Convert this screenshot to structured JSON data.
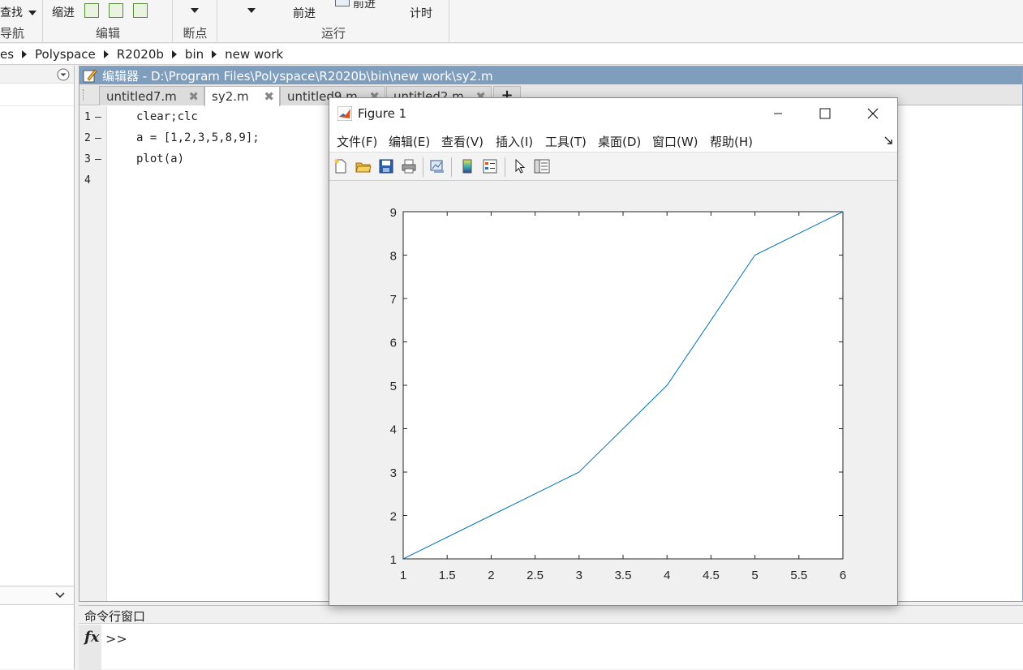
{
  "ribbon": {
    "find_label": "查找",
    "nav_label": "导航",
    "indent_label": "缩进",
    "edit_section": "编辑",
    "breakpoint_section": "断点",
    "run_section": "运行",
    "run_forward_label": "前进",
    "forward_label": "前进",
    "timer_label": "计时"
  },
  "address": {
    "segments": [
      "es",
      "Polyspace",
      "R2020b",
      "bin",
      "new work"
    ]
  },
  "editor": {
    "title": "编辑器 - D:\\Program Files\\Polyspace\\R2020b\\bin\\new work\\sy2.m",
    "tabs": [
      {
        "label": "untitled7.m"
      },
      {
        "label": "sy2.m"
      },
      {
        "label": "untitled9.m"
      },
      {
        "label": "untitled2.m"
      }
    ],
    "add_tab": "+",
    "lines": [
      {
        "num": "1",
        "marker": "—",
        "code": "clear;clc"
      },
      {
        "num": "2",
        "marker": "—",
        "code": "a = [1,2,3,5,8,9];"
      },
      {
        "num": "3",
        "marker": "—",
        "code": "plot(a)"
      },
      {
        "num": "4",
        "marker": "",
        "code": ""
      }
    ]
  },
  "command": {
    "title": "命令行窗口",
    "fx": "fx",
    "prompt": ">>"
  },
  "figure": {
    "title": "Figure 1",
    "menu": [
      "文件(F)",
      "编辑(E)",
      "查看(V)",
      "插入(I)",
      "工具(T)",
      "桌面(D)",
      "窗口(W)",
      "帮助(H)"
    ],
    "toolbar_icons": [
      "new-figure-icon",
      "open-file-icon",
      "save-icon",
      "print-icon",
      "link-plot-icon",
      "colorbar-icon",
      "legend-icon",
      "pointer-icon",
      "property-inspector-icon"
    ]
  },
  "chart_data": {
    "type": "line",
    "x": [
      1,
      2,
      3,
      4,
      5,
      6
    ],
    "series": [
      {
        "values": [
          1,
          2,
          3,
          5,
          8,
          9
        ],
        "color": "#0072bd"
      }
    ],
    "xlim": [
      1,
      6
    ],
    "ylim": [
      1,
      9
    ],
    "xticks": [
      "1",
      "1.5",
      "2",
      "2.5",
      "3",
      "3.5",
      "4",
      "4.5",
      "5",
      "5.5",
      "6"
    ],
    "xtick_values": [
      1,
      1.5,
      2,
      2.5,
      3,
      3.5,
      4,
      4.5,
      5,
      5.5,
      6
    ],
    "yticks": [
      "1",
      "2",
      "3",
      "4",
      "5",
      "6",
      "7",
      "8",
      "9"
    ],
    "ytick_values": [
      1,
      2,
      3,
      4,
      5,
      6,
      7,
      8,
      9
    ],
    "grid": false
  }
}
